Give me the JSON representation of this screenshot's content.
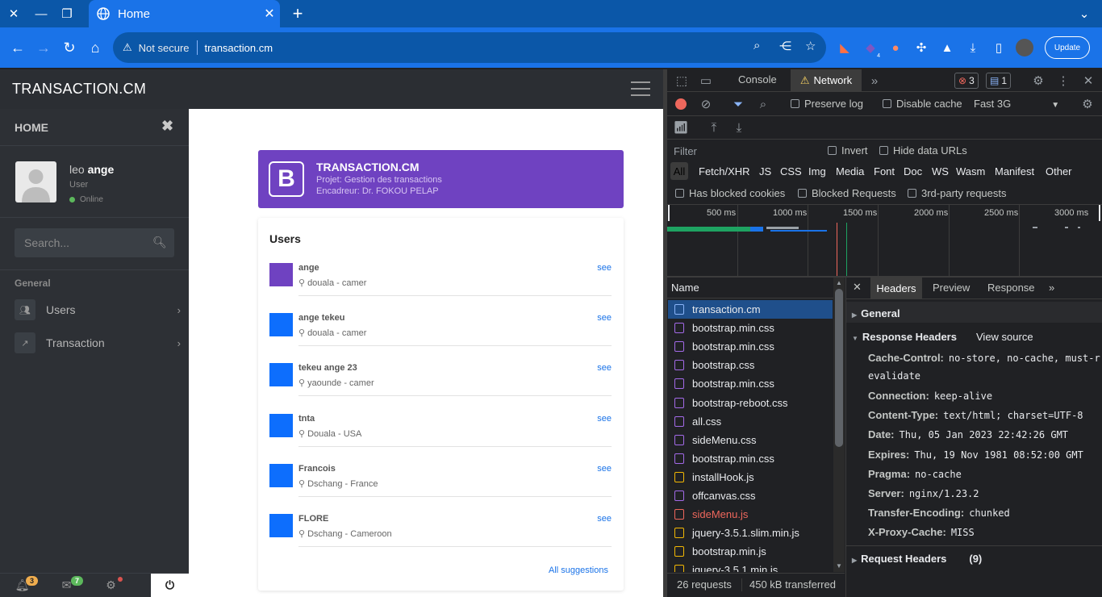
{
  "browser": {
    "tab_title": "Home",
    "not_secure": "Not secure",
    "url": "transaction.cm",
    "update_label": "Update",
    "ext_badge": "4"
  },
  "app": {
    "brand": "TRANSACTION.CM",
    "sidebar": {
      "home": "HOME",
      "user_first": "leo",
      "user_last": "ange",
      "role": "User",
      "status": "Online",
      "search_placeholder": "Search...",
      "section": "General",
      "menu": [
        {
          "label": "Users"
        },
        {
          "label": "Transaction"
        }
      ],
      "footer": {
        "notif_count": "3",
        "mail_count": "7"
      }
    },
    "header_card": {
      "logo": "B",
      "title": "TRANSACTION.CM",
      "line1": "Projet: Gestion des transactions",
      "line2": "Encadreur: Dr. FOKOU PELAP"
    },
    "users_card": {
      "title": "Users",
      "users": [
        {
          "name": "ange",
          "location": "douala - camer",
          "action": "see",
          "color": "#6f42c1"
        },
        {
          "name": "ange tekeu",
          "location": "douala - camer",
          "action": "see",
          "color": "#0d6efd"
        },
        {
          "name": "tekeu ange 23",
          "location": "yaounde - camer",
          "action": "see",
          "color": "#0d6efd"
        },
        {
          "name": "tnta",
          "location": "Douala - USA",
          "action": "see",
          "color": "#0d6efd"
        },
        {
          "name": "Francois",
          "location": "Dschang - France",
          "action": "see",
          "color": "#0d6efd"
        },
        {
          "name": "FLORE",
          "location": "Dschang - Cameroon",
          "action": "see",
          "color": "#0d6efd"
        }
      ],
      "all_suggestions": "All suggestions"
    }
  },
  "devtools": {
    "tabs": {
      "console": "Console",
      "network": "Network"
    },
    "errors": "3",
    "messages": "1",
    "preserve_log": "Preserve log",
    "disable_cache": "Disable cache",
    "throttle": "Fast 3G",
    "filter_placeholder": "Filter",
    "invert": "Invert",
    "hide_data_urls": "Hide data URLs",
    "types": [
      "All",
      "Fetch/XHR",
      "JS",
      "CSS",
      "Img",
      "Media",
      "Font",
      "Doc",
      "WS",
      "Wasm",
      "Manifest",
      "Other"
    ],
    "has_blocked_cookies": "Has blocked cookies",
    "blocked_requests": "Blocked Requests",
    "third_party": "3rd-party requests",
    "timeline_ticks": [
      "500 ms",
      "1000 ms",
      "1500 ms",
      "2000 ms",
      "2500 ms",
      "3000 ms"
    ],
    "name_col": "Name",
    "requests": [
      {
        "name": "transaction.cm",
        "kind": "doc"
      },
      {
        "name": "bootstrap.min.css",
        "kind": "css"
      },
      {
        "name": "bootstrap.min.css",
        "kind": "css"
      },
      {
        "name": "bootstrap.css",
        "kind": "css"
      },
      {
        "name": "bootstrap.min.css",
        "kind": "css"
      },
      {
        "name": "bootstrap-reboot.css",
        "kind": "css"
      },
      {
        "name": "all.css",
        "kind": "css"
      },
      {
        "name": "sideMenu.css",
        "kind": "css"
      },
      {
        "name": "bootstrap.min.css",
        "kind": "css"
      },
      {
        "name": "installHook.js",
        "kind": "js"
      },
      {
        "name": "offcanvas.css",
        "kind": "css"
      },
      {
        "name": "sideMenu.js",
        "kind": "err"
      },
      {
        "name": "jquery-3.5.1.slim.min.js",
        "kind": "js"
      },
      {
        "name": "bootstrap.min.js",
        "kind": "js"
      },
      {
        "name": "jquery-3.5.1.min.js",
        "kind": "js"
      }
    ],
    "summary_requests": "26 requests",
    "summary_transferred": "450 kB transferred",
    "detail_tabs": {
      "headers": "Headers",
      "preview": "Preview",
      "response": "Response"
    },
    "general": "General",
    "response_headers": "Response Headers",
    "view_source": "View source",
    "headers": [
      {
        "key": "Cache-Control:",
        "value": "no-store, no-cache, must-r"
      },
      {
        "key": "",
        "value": "evalidate"
      },
      {
        "key": "Connection:",
        "value": "keep-alive"
      },
      {
        "key": "Content-Type:",
        "value": "text/html; charset=UTF-8"
      },
      {
        "key": "Date:",
        "value": "Thu, 05 Jan 2023 22:42:26 GMT"
      },
      {
        "key": "Expires:",
        "value": "Thu, 19 Nov 1981 08:52:00 GMT"
      },
      {
        "key": "Pragma:",
        "value": "no-cache"
      },
      {
        "key": "Server:",
        "value": "nginx/1.23.2"
      },
      {
        "key": "Transfer-Encoding:",
        "value": "chunked"
      },
      {
        "key": "X-Proxy-Cache:",
        "value": "MISS"
      }
    ],
    "request_headers": "Request Headers",
    "request_headers_count": "(9)"
  },
  "colors": {
    "accent": "#1a73e8",
    "purple": "#6f42c1",
    "error": "#ee675c"
  }
}
